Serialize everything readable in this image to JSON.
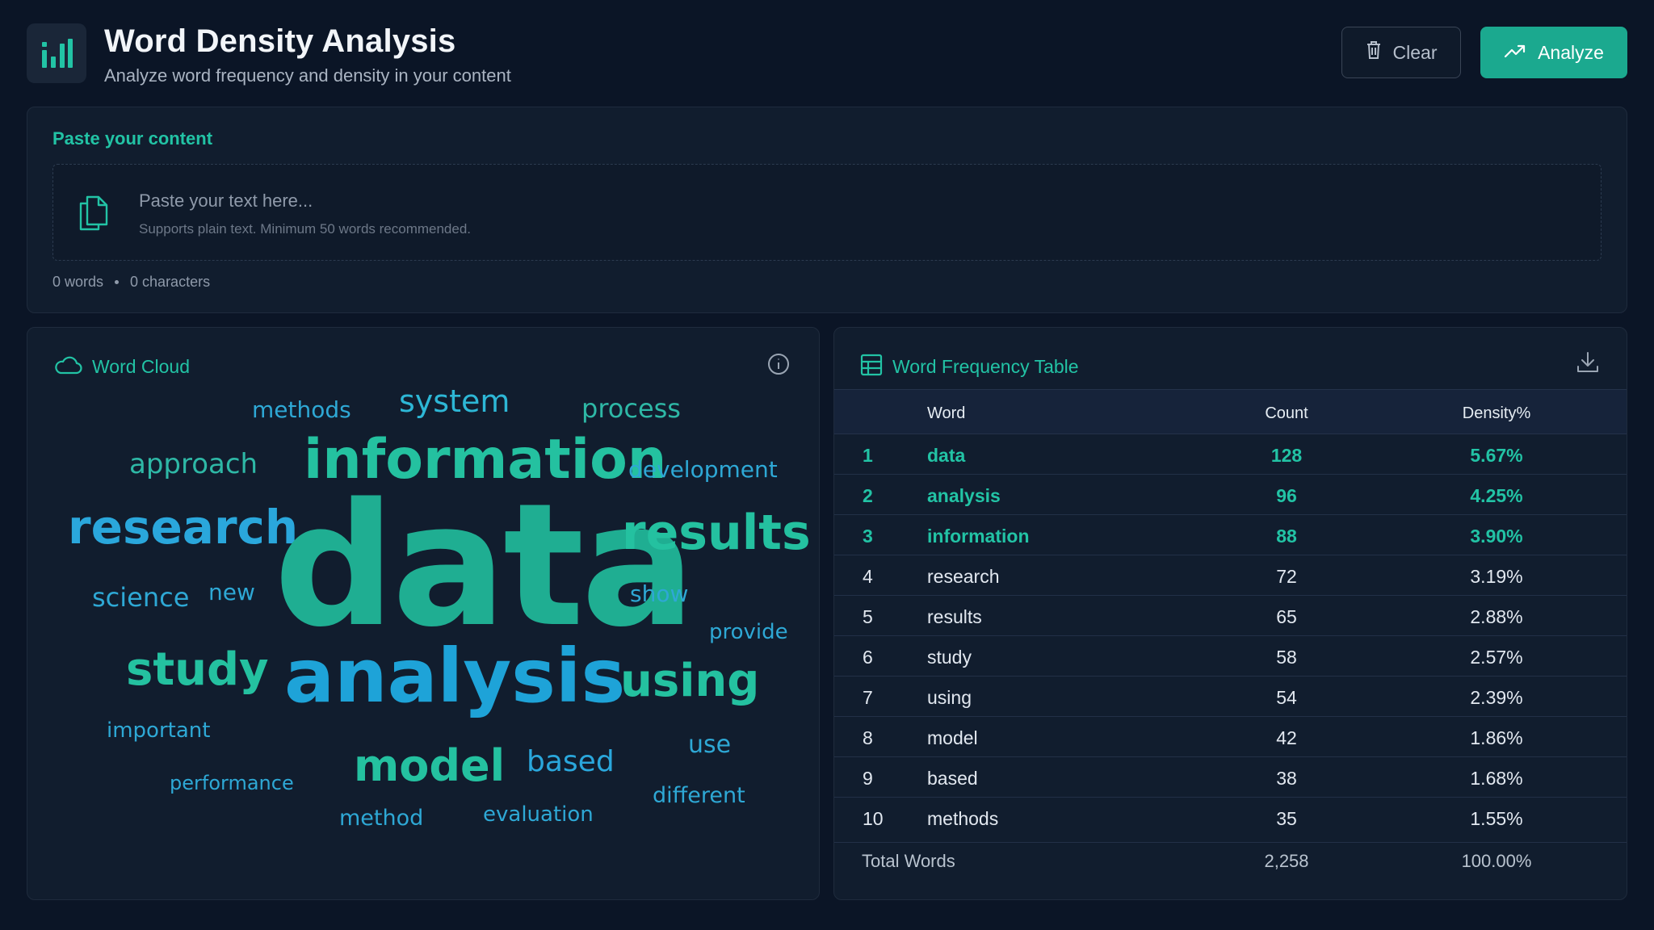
{
  "header": {
    "title": "Word Density Analysis",
    "subtitle": "Analyze word frequency and density in your content",
    "clear_label": "Clear",
    "analyze_label": "Analyze"
  },
  "paste": {
    "heading": "Paste your content",
    "placeholder": "Paste your text here...",
    "hint": "Supports plain text. Minimum 50 words recommended.",
    "word_count": "0 words",
    "char_count": "0 characters"
  },
  "cloud": {
    "title": "Word Cloud",
    "words": [
      {
        "text": "methods"
      },
      {
        "text": "system"
      },
      {
        "text": "process"
      },
      {
        "text": "approach"
      },
      {
        "text": "information"
      },
      {
        "text": "development"
      },
      {
        "text": "research"
      },
      {
        "text": "data"
      },
      {
        "text": "results"
      },
      {
        "text": "science"
      },
      {
        "text": "new"
      },
      {
        "text": "show"
      },
      {
        "text": "provide"
      },
      {
        "text": "study"
      },
      {
        "text": "analysis"
      },
      {
        "text": "using"
      },
      {
        "text": "important"
      },
      {
        "text": "use"
      },
      {
        "text": "model"
      },
      {
        "text": "based"
      },
      {
        "text": "performance"
      },
      {
        "text": "different"
      },
      {
        "text": "method"
      },
      {
        "text": "evaluation"
      }
    ]
  },
  "table": {
    "title": "Word Frequency Table",
    "columns": {
      "word": "Word",
      "count": "Count",
      "density": "Density%"
    },
    "rows": [
      {
        "rank": "1",
        "word": "data",
        "count": "128",
        "density": "5.67%"
      },
      {
        "rank": "2",
        "word": "analysis",
        "count": "96",
        "density": "4.25%"
      },
      {
        "rank": "3",
        "word": "information",
        "count": "88",
        "density": "3.90%"
      },
      {
        "rank": "4",
        "word": "research",
        "count": "72",
        "density": "3.19%"
      },
      {
        "rank": "5",
        "word": "results",
        "count": "65",
        "density": "2.88%"
      },
      {
        "rank": "6",
        "word": "study",
        "count": "58",
        "density": "2.57%"
      },
      {
        "rank": "7",
        "word": "using",
        "count": "54",
        "density": "2.39%"
      },
      {
        "rank": "8",
        "word": "model",
        "count": "42",
        "density": "1.86%"
      },
      {
        "rank": "9",
        "word": "based",
        "count": "38",
        "density": "1.68%"
      },
      {
        "rank": "10",
        "word": "methods",
        "count": "35",
        "density": "1.55%"
      }
    ],
    "footer": {
      "label": "Total Words",
      "count": "2,258",
      "density": "100.00%"
    }
  },
  "colors": {
    "accent": "#22c3a5",
    "button": "#1ba98f",
    "background": "#0b1526",
    "card": "#111d2e"
  },
  "icons": {
    "logo": "bar-chart-icon",
    "clear": "trash-icon",
    "analyze": "trending-up-icon",
    "paste": "copy-icon",
    "cloud": "cloud-icon",
    "info": "info-icon",
    "table": "table-icon",
    "download": "download-icon"
  }
}
